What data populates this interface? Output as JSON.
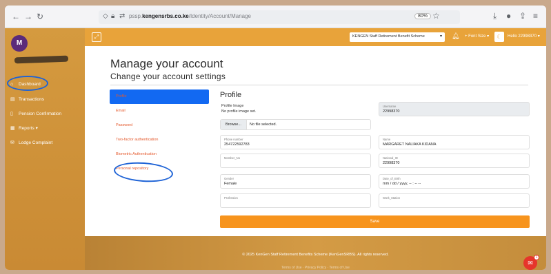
{
  "browser": {
    "url_prefix": "pssp.",
    "url_domain": "kengensrbs.co.ke",
    "url_path": "/Identity/Account/Manage",
    "zoom": "80%"
  },
  "sidebar": {
    "avatar_initial": "M",
    "items": [
      {
        "label": "Dashboard",
        "icon": "home-icon"
      },
      {
        "label": "Transactions",
        "icon": "table-icon"
      },
      {
        "label": "Pension Confirmation",
        "icon": "document-icon"
      },
      {
        "label": "Reports ▾",
        "icon": "chart-icon"
      },
      {
        "label": "Lodge Complaint",
        "icon": "message-icon"
      }
    ]
  },
  "appbar": {
    "scheme": "KENGEN Staff Retirement Benefit Scheme",
    "font_size_label": "Font Size ▾",
    "user_label": "Hello 22998370 ▾"
  },
  "page": {
    "title": "Manage your account",
    "subtitle": "Change your account settings"
  },
  "subnav": [
    {
      "label": "Profile",
      "active": true
    },
    {
      "label": "Email",
      "active": false
    },
    {
      "label": "Password",
      "active": false
    },
    {
      "label": "Two-factor authentication",
      "active": false
    },
    {
      "label": "Biometric Authentication",
      "active": false
    },
    {
      "label": "Personal repository",
      "active": false
    }
  ],
  "profile": {
    "heading": "Profile",
    "image_label": "Profile Image",
    "image_note": "No profile image set.",
    "browse_label": "Browse...",
    "file_status": "No file selected.",
    "fields": {
      "username": {
        "label": "Username",
        "value": "22998370"
      },
      "phone": {
        "label": "Phone number",
        "value": "254722592783"
      },
      "name": {
        "label": "Name",
        "value": "MARGARET NALIAKA KIDANA"
      },
      "member_no": {
        "label": "Member_No",
        "value": ""
      },
      "national_id": {
        "label": "National_ID",
        "value": "22998370"
      },
      "gender": {
        "label": "Gender",
        "value": "Female"
      },
      "dob": {
        "label": "Date_of_Birth",
        "value": "mm / dd / yyyy, -- : -- --"
      },
      "profession": {
        "label": "Profession",
        "value": ""
      },
      "work_station": {
        "label": "Work_Station",
        "value": ""
      }
    },
    "save_label": "Save"
  },
  "footer": {
    "copyright": "© 2025 KenGen Staff Retirement Benefits Scheme (KenGenSRBS). All rights reserved.",
    "links": "Terms of Use · Privacy Policy · Terms of Use"
  },
  "chat": {
    "badge": "1"
  }
}
